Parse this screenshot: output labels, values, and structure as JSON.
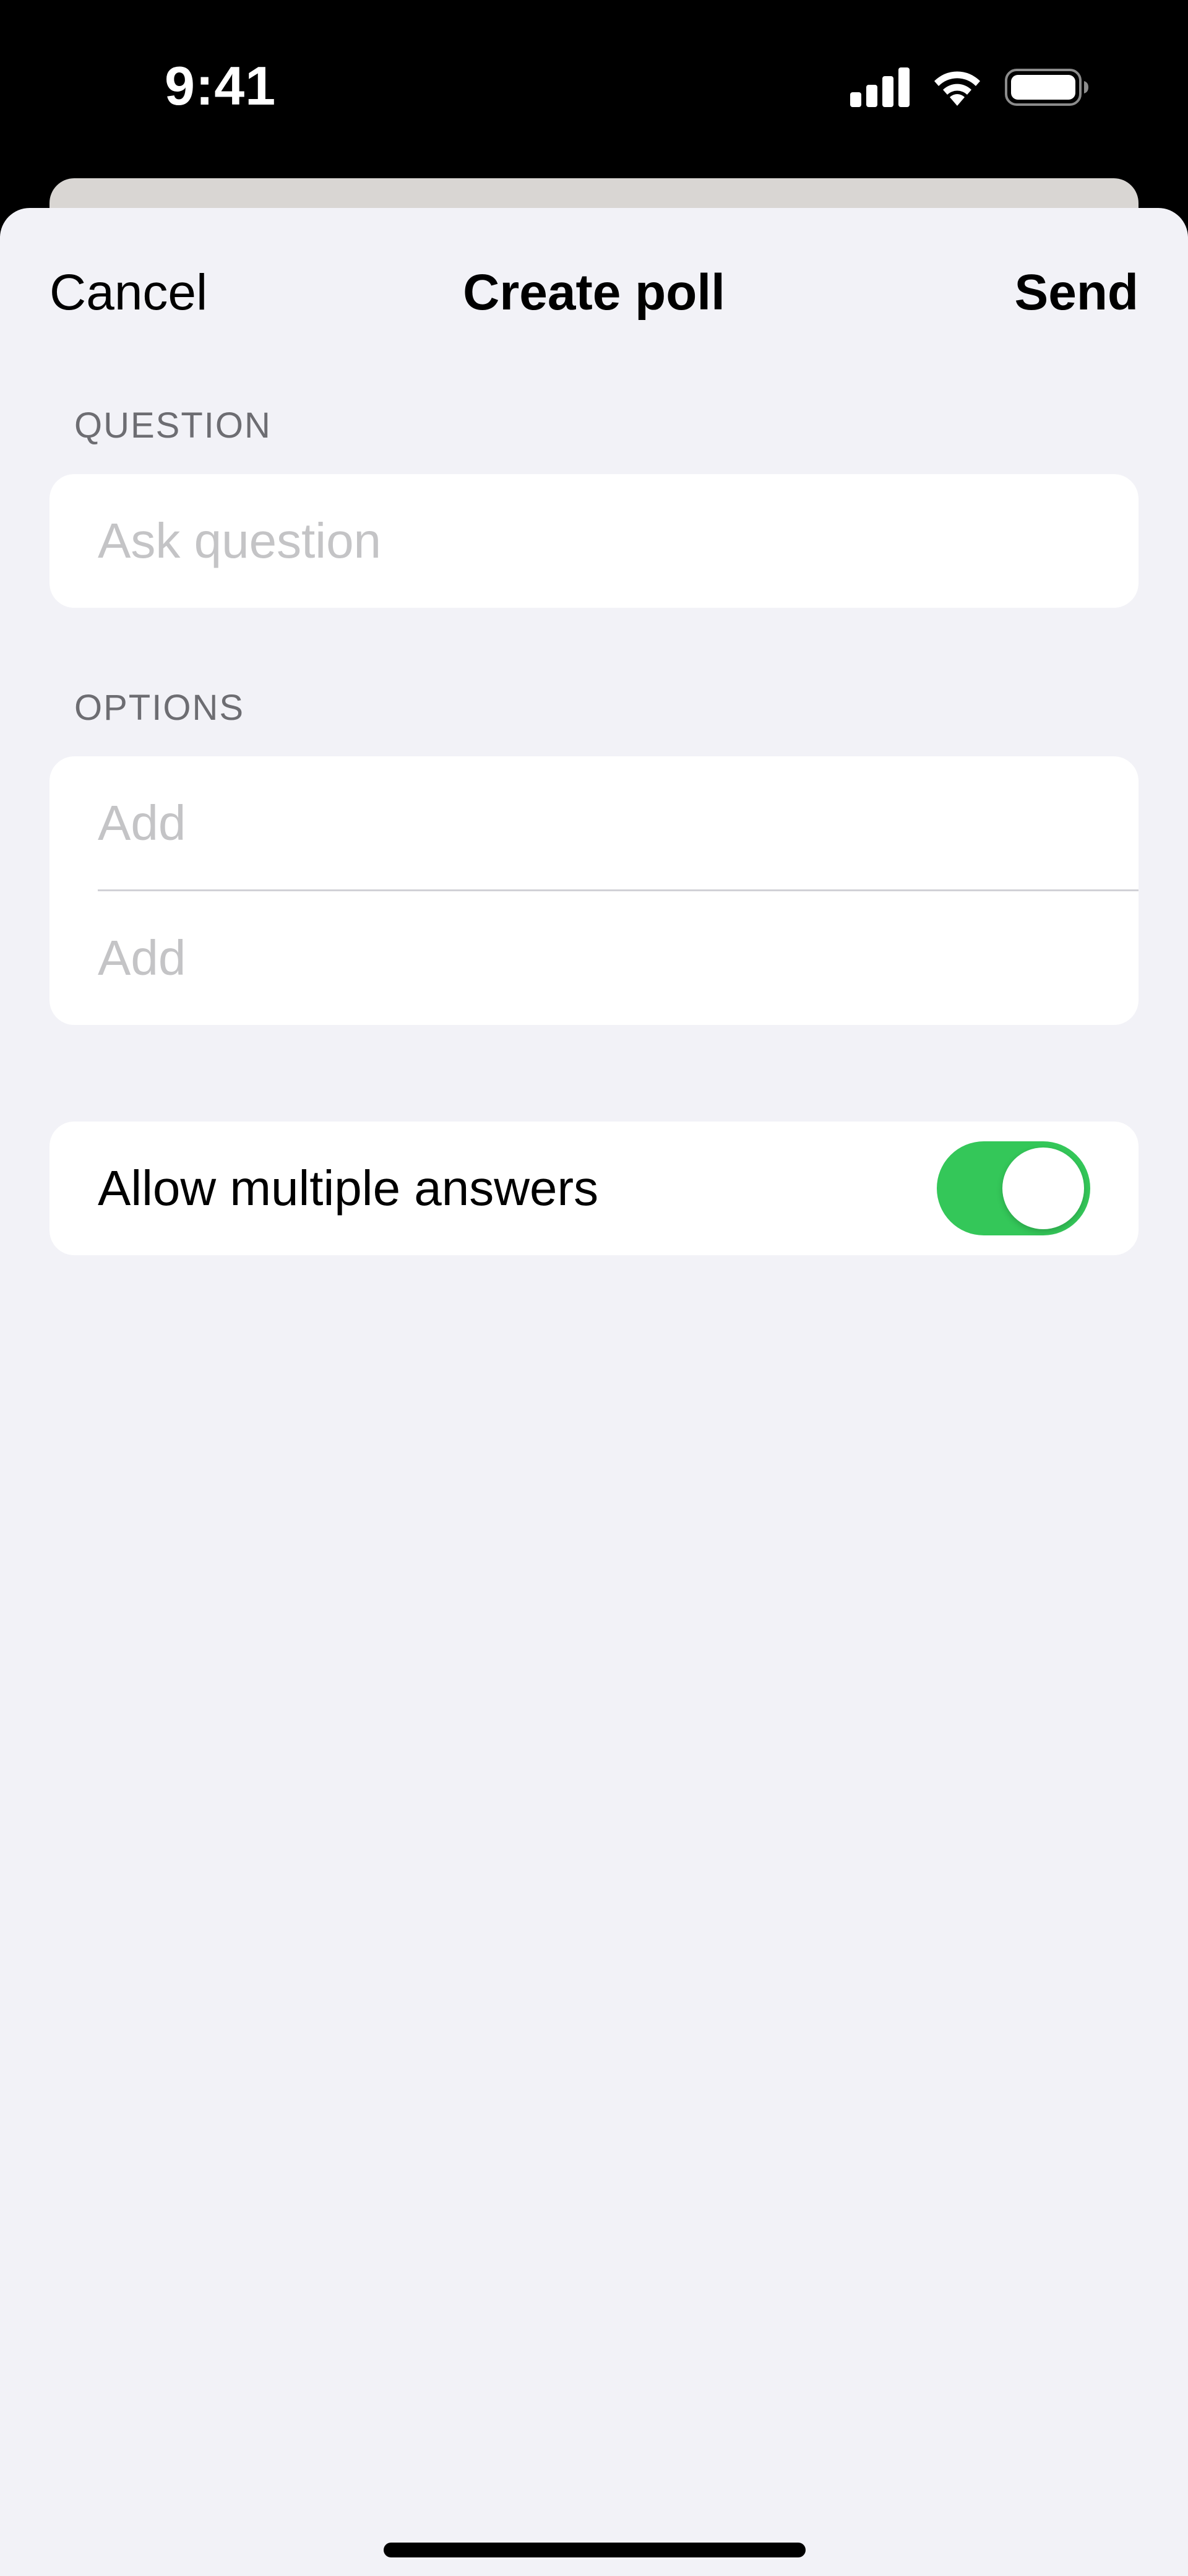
{
  "status_bar": {
    "time": "9:41",
    "icons": [
      "cellular-signal-icon",
      "wifi-icon",
      "battery-icon"
    ]
  },
  "nav": {
    "cancel_label": "Cancel",
    "title": "Create poll",
    "send_label": "Send"
  },
  "question_section": {
    "label": "QUESTION",
    "placeholder": "Ask question",
    "value": ""
  },
  "options_section": {
    "label": "OPTIONS",
    "options": [
      {
        "placeholder": "Add",
        "value": ""
      },
      {
        "placeholder": "Add",
        "value": ""
      }
    ]
  },
  "settings": {
    "allow_multiple_label": "Allow multiple answers",
    "allow_multiple_on": true
  },
  "colors": {
    "toggle_on": "#34c759",
    "sheet_background": "#f2f2f7",
    "placeholder": "#c4c4c6",
    "section_label": "#6d6d72"
  }
}
